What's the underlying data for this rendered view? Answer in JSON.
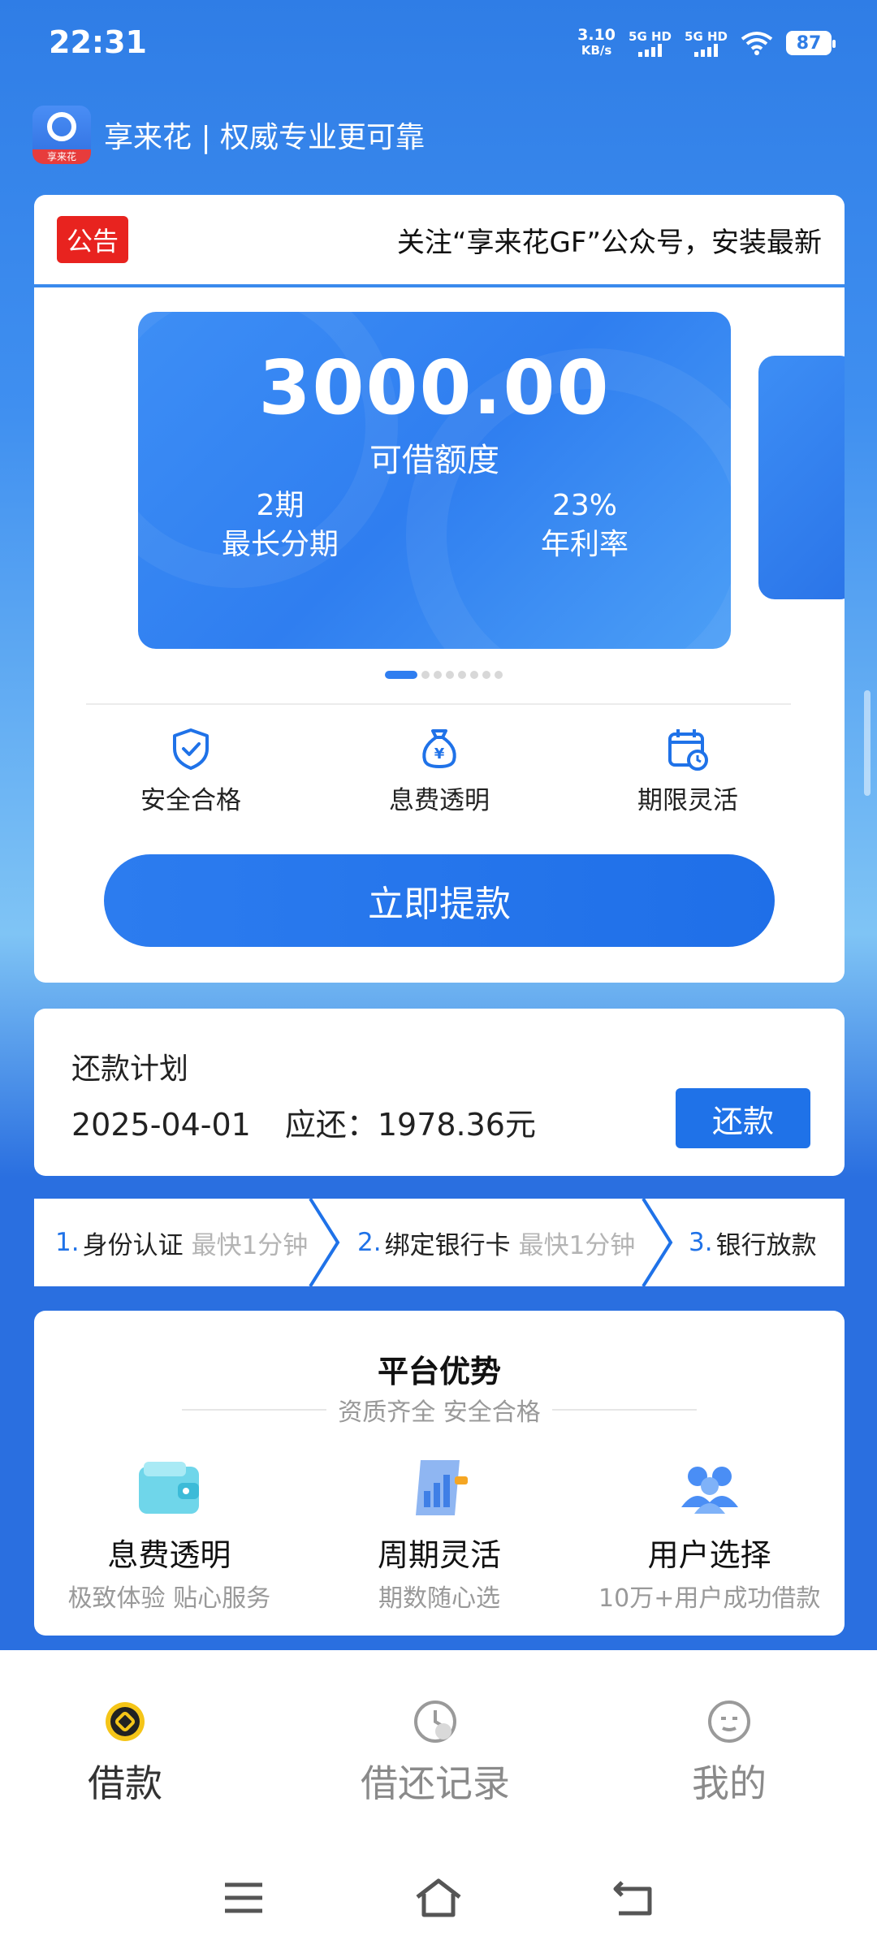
{
  "status_bar": {
    "time": "22:31",
    "net_speed_value": "3.10",
    "net_speed_unit": "KB/s",
    "sim1_label": "5G HD",
    "sim2_label": "5G HD",
    "battery": "87",
    "icons": [
      "signal-bars-icon",
      "wifi-icon",
      "battery-icon"
    ]
  },
  "header": {
    "logo_text": "享来花",
    "title": "享来花 | 权威专业更可靠"
  },
  "notice": {
    "badge": "公告",
    "text": "关注“享来花GF”公众号，安装最新"
  },
  "credit_card": {
    "amount": "3000.00",
    "amount_label": "可借额度",
    "term_value": "2期",
    "term_label": "最长分期",
    "rate_value": "23%",
    "rate_label": "年利率",
    "carousel_count": 8,
    "carousel_active_index": 0
  },
  "features": [
    {
      "label": "安全合格",
      "icon": "shield-check-icon"
    },
    {
      "label": "息费透明",
      "icon": "money-bag-icon"
    },
    {
      "label": "期限灵活",
      "icon": "calendar-clock-icon"
    }
  ],
  "cta": {
    "label": "立即提款"
  },
  "repay": {
    "title": "还款计划",
    "date": "2025-04-01",
    "due": "应还：1978.36元",
    "button": "还款"
  },
  "steps": [
    {
      "num": "1.",
      "name": "身份认证",
      "hint": "最快1分钟"
    },
    {
      "num": "2.",
      "name": "绑定银行卡",
      "hint": "最快1分钟"
    },
    {
      "num": "3.",
      "name": "银行放款",
      "hint": ""
    }
  ],
  "advantages": {
    "title": "平台优势",
    "subtitle": "资质齐全 安全合格",
    "items": [
      {
        "title": "息费透明",
        "desc": "极致体验 贴心服务",
        "icon": "wallet-icon"
      },
      {
        "title": "周期灵活",
        "desc": "期数随心选",
        "icon": "chart-document-icon"
      },
      {
        "title": "用户选择",
        "desc": "10万+用户成功借款",
        "icon": "users-icon"
      }
    ]
  },
  "tabbar": {
    "active": 0,
    "tabs": [
      {
        "label": "借款",
        "icon": "loan-icon"
      },
      {
        "label": "借还记录",
        "icon": "clock-icon"
      },
      {
        "label": "我的",
        "icon": "face-icon"
      }
    ]
  },
  "colors": {
    "primary": "#1f72e8",
    "notice_red": "#e8231f",
    "tab_active_accent": "#f5c518"
  }
}
